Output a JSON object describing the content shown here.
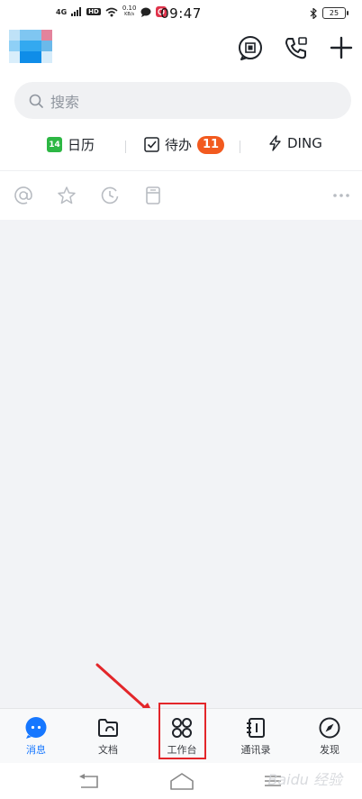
{
  "status_bar": {
    "network": "4G",
    "hd": "HD",
    "speed_value": "0.10",
    "speed_unit": "KB/s",
    "time": "09:47",
    "battery": "25"
  },
  "search": {
    "placeholder": "搜索"
  },
  "quick_actions": {
    "calendar_day": "14",
    "calendar_label": "日历",
    "todo_label": "待办",
    "todo_count": "11",
    "ding_label": "DING"
  },
  "bottom_nav": {
    "items": [
      {
        "label": "消息",
        "active": true
      },
      {
        "label": "文档",
        "active": false
      },
      {
        "label": "工作台",
        "active": false
      },
      {
        "label": "通讯录",
        "active": false
      },
      {
        "label": "发现",
        "active": false
      }
    ]
  },
  "watermark": "Baidu 经验",
  "colors": {
    "accent": "#1677ff",
    "calendar_green": "#2db744",
    "badge_orange": "#f25a1f",
    "annotation_red": "#e3262a"
  }
}
